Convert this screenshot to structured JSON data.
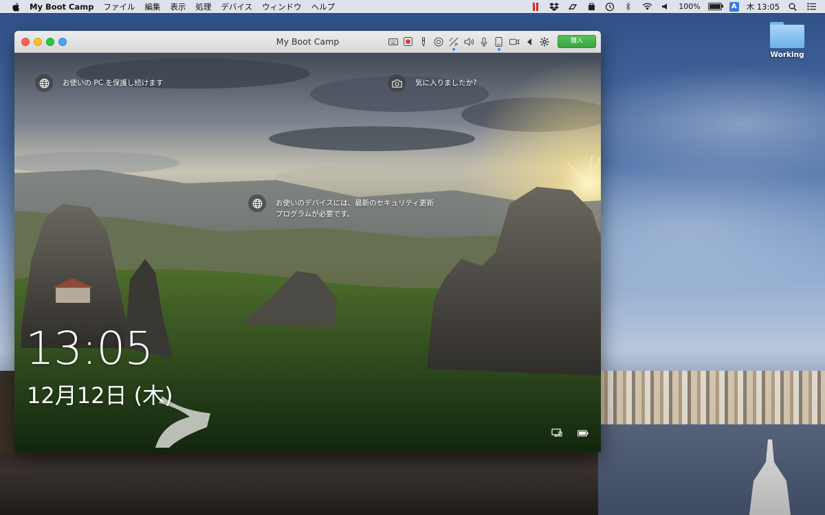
{
  "menubar": {
    "app_name": "My Boot Camp",
    "menus": [
      "ファイル",
      "編集",
      "表示",
      "処理",
      "デバイス",
      "ウィンドウ",
      "ヘルプ"
    ],
    "battery_percent": "100%",
    "input_method": "A",
    "clock": "木 13:05"
  },
  "desktop": {
    "folder_label": "Working"
  },
  "window": {
    "title": "My Boot Camp",
    "buy_button": "購入"
  },
  "lockscreen": {
    "time": "13:05",
    "date": "12月12日 (木)",
    "hint_protect": "お使いの PC を保護し続けます",
    "hint_like": "気に入りましたか?",
    "hint_security": "お使いのデバイスには、最新のセキュリティ更新\nプログラムが必要です。"
  },
  "colors": {
    "buy_button": "#45b24a",
    "parallels_red": "#d7262e",
    "accent_blue": "#3a88f5"
  }
}
